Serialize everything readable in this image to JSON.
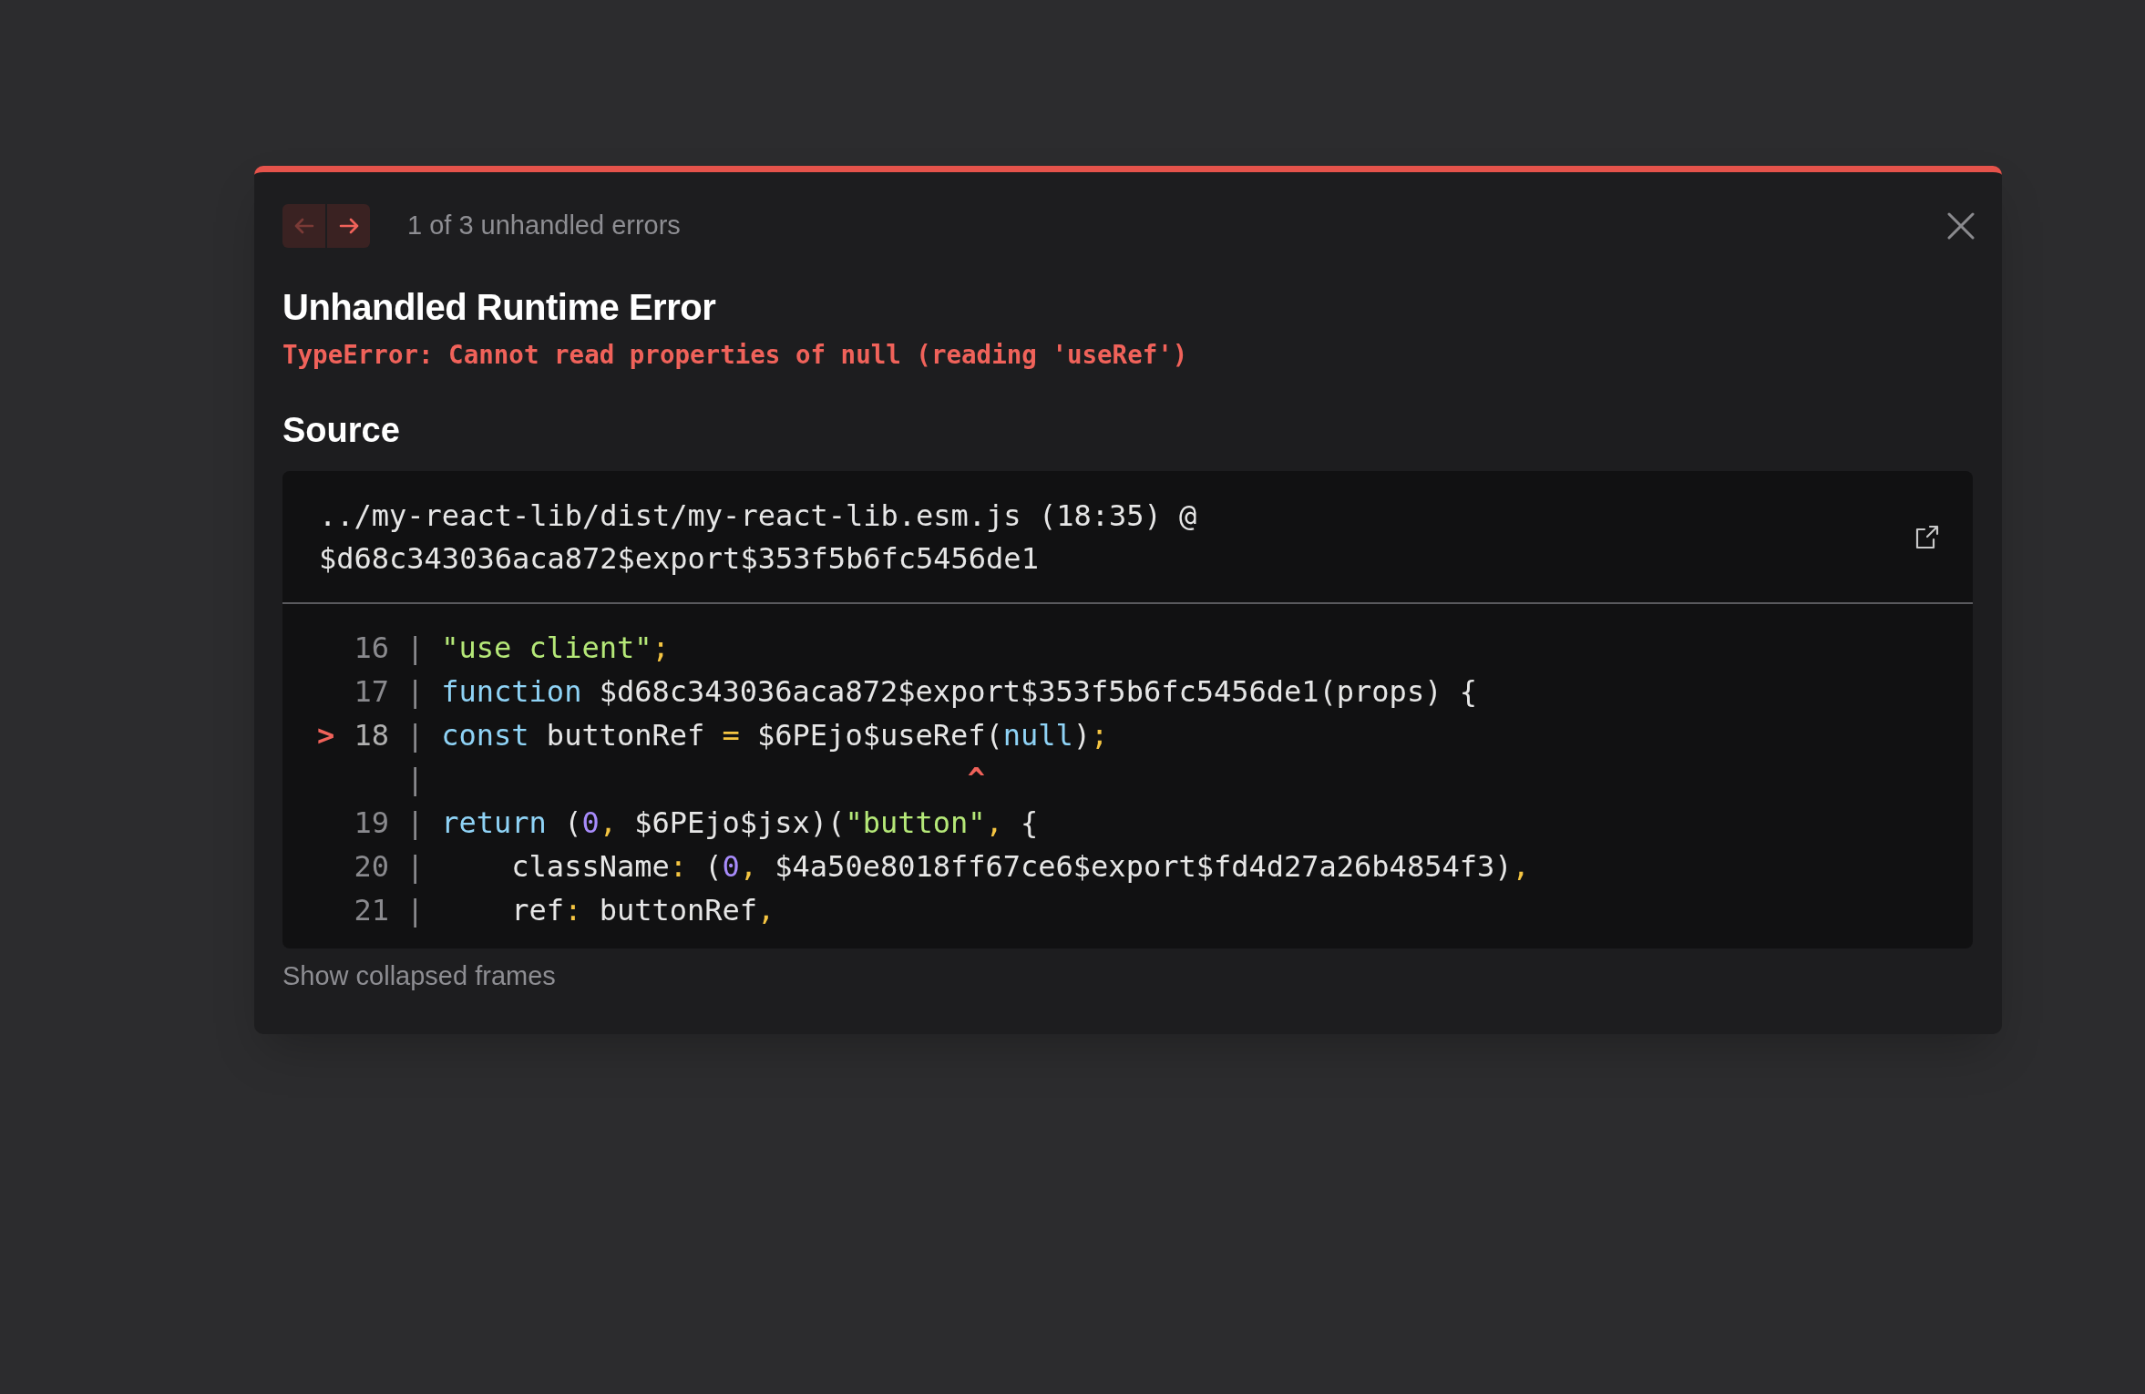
{
  "dialog": {
    "navigation": [
      {
        "kind": "previous",
        "disabled": true
      },
      {
        "kind": "next",
        "disabled": false
      }
    ],
    "counter": "1 of 3 unhandled errors",
    "title": "Unhandled Runtime Error",
    "message": "TypeError: Cannot read properties of null (reading 'useRef')",
    "source": {
      "heading": "Source",
      "location": [
        "../my-react-lib/dist/my-react-lib.esm.js (18:35) @",
        "$d68c343036aca872$export$353f5b6fc5456de1"
      ],
      "lines": [
        {
          "number": "16",
          "separator": "|",
          "highlighted": false,
          "tokens": [
            {
              "kind": "string",
              "text": "\"use client\""
            },
            {
              "kind": "punct",
              "text": ";"
            }
          ]
        },
        {
          "number": "17",
          "separator": "|",
          "highlighted": false,
          "tokens": [
            {
              "kind": "keyword",
              "text": "function"
            },
            {
              "kind": "plain",
              "text": " $d68c343036aca872$export$353f5b6fc5456de1(props) {"
            }
          ]
        },
        {
          "number": "18",
          "separator": "|",
          "highlighted": true,
          "marker": ">",
          "tokens": [
            {
              "kind": "keyword",
              "text": "const"
            },
            {
              "kind": "plain",
              "text": " buttonRef "
            },
            {
              "kind": "punct",
              "text": "="
            },
            {
              "kind": "plain",
              "text": " $6PEjo$useRef("
            },
            {
              "kind": "keyword",
              "text": "null"
            },
            {
              "kind": "plain",
              "text": ")"
            },
            {
              "kind": "punct",
              "text": ";"
            }
          ]
        },
        {
          "separator": "|",
          "caret": "^"
        },
        {
          "number": "19",
          "separator": "|",
          "highlighted": false,
          "tokens": [
            {
              "kind": "keyword",
              "text": "return"
            },
            {
              "kind": "plain",
              "text": " ("
            },
            {
              "kind": "number",
              "text": "0"
            },
            {
              "kind": "punct",
              "text": ","
            },
            {
              "kind": "plain",
              "text": " $6PEjo$jsx)("
            },
            {
              "kind": "string",
              "text": "\"button\""
            },
            {
              "kind": "punct",
              "text": ","
            },
            {
              "kind": "plain",
              "text": " {"
            }
          ]
        },
        {
          "number": "20",
          "separator": "|",
          "highlighted": false,
          "tokens": [
            {
              "kind": "plain",
              "text": "    className"
            },
            {
              "kind": "punct",
              "text": ":"
            },
            {
              "kind": "plain",
              "text": " ("
            },
            {
              "kind": "number",
              "text": "0"
            },
            {
              "kind": "punct",
              "text": ","
            },
            {
              "kind": "plain",
              "text": " $4a50e8018ff67ce6$export$fd4d27a26b4854f3)"
            },
            {
              "kind": "punct",
              "text": ","
            }
          ]
        },
        {
          "number": "21",
          "separator": "|",
          "highlighted": false,
          "tokens": [
            {
              "kind": "plain",
              "text": "    ref"
            },
            {
              "kind": "punct",
              "text": ":"
            },
            {
              "kind": "plain",
              "text": " buttonRef"
            },
            {
              "kind": "punct",
              "text": ","
            }
          ]
        }
      ]
    },
    "footer_link": "Show collapsed frames"
  }
}
